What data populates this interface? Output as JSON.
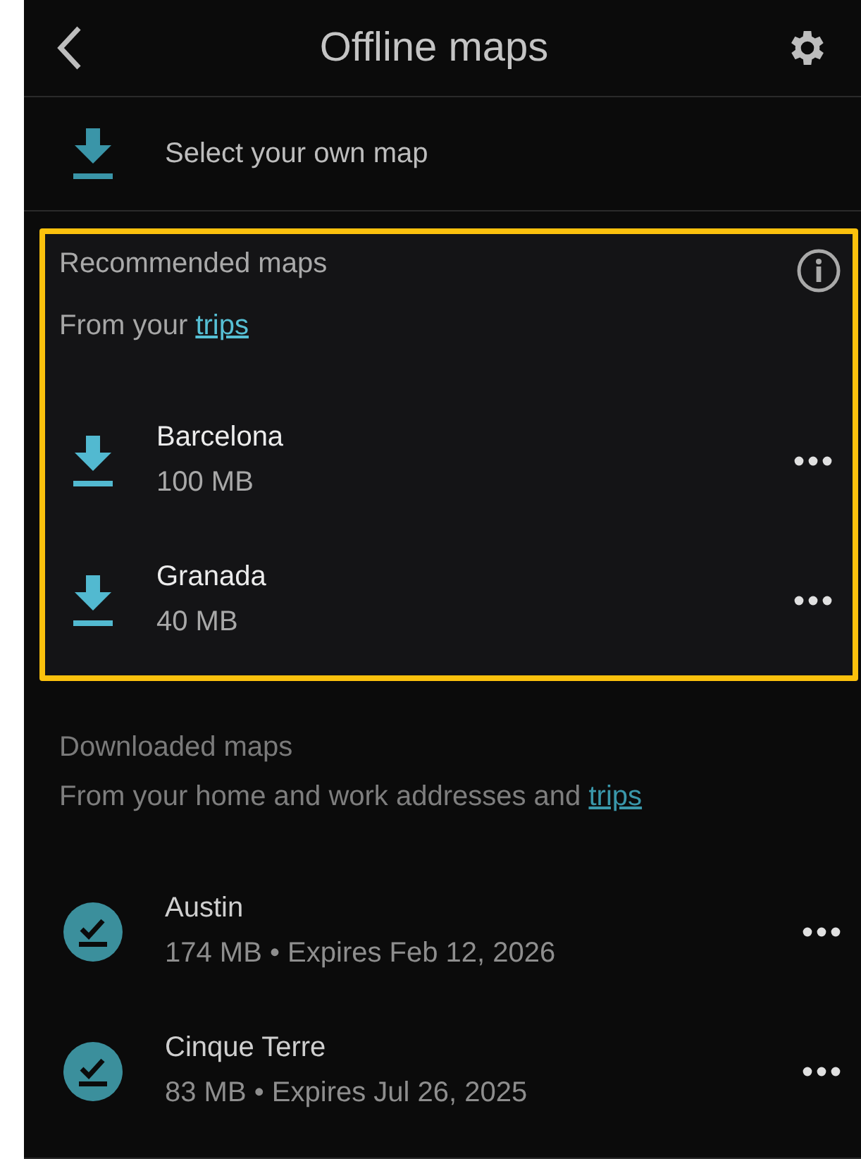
{
  "header": {
    "title": "Offline maps"
  },
  "select_own_map": {
    "label": "Select your own map"
  },
  "sections": [
    {
      "title": "Recommended maps",
      "highlighted": true,
      "info": true,
      "subtitle": {
        "text": "From your ",
        "link": "trips"
      },
      "items": [
        {
          "kind": "download",
          "name": "Barcelona",
          "detail": "100 MB"
        },
        {
          "kind": "download",
          "name": "Granada",
          "detail": "40 MB"
        }
      ]
    },
    {
      "title": "Downloaded maps",
      "highlighted": false,
      "info": false,
      "subtitle": {
        "text": "From your home and work addresses and ",
        "link": "trips"
      },
      "items": [
        {
          "kind": "downloaded",
          "name": "Austin",
          "detail": "174 MB • Expires Feb 12, 2026"
        },
        {
          "kind": "downloaded",
          "name": "Cinque Terre",
          "detail": "83 MB • Expires Jul 26, 2025"
        }
      ]
    }
  ]
}
